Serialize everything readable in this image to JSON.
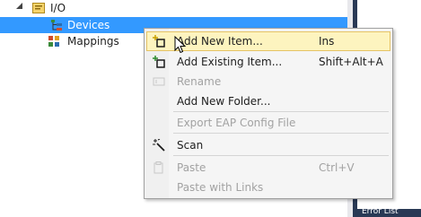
{
  "tree": {
    "items": [
      {
        "label": "I/O",
        "icon": "io-folder-icon",
        "expanded": true,
        "selected": false
      },
      {
        "label": "Devices",
        "icon": "devices-icon",
        "selected": true
      },
      {
        "label": "Mappings",
        "icon": "mappings-icon",
        "selected": false
      }
    ]
  },
  "context_menu": {
    "items": [
      {
        "label": "Add New Item...",
        "shortcut": "Ins",
        "icon": "add-new-item-icon",
        "enabled": true,
        "highlighted": true
      },
      {
        "label": "Add Existing Item...",
        "shortcut": "Shift+Alt+A",
        "icon": "add-existing-item-icon",
        "enabled": true
      },
      {
        "label": "Rename",
        "shortcut": "",
        "icon": "rename-icon",
        "enabled": false
      },
      {
        "label": "Add New Folder...",
        "shortcut": "",
        "enabled": true
      },
      {
        "label": "Export EAP Config File",
        "shortcut": "",
        "enabled": false
      },
      {
        "label": "Scan",
        "shortcut": "",
        "icon": "scan-wand-icon",
        "enabled": true
      },
      {
        "label": "Paste",
        "shortcut": "Ctrl+V",
        "icon": "paste-icon",
        "enabled": false
      },
      {
        "label": "Paste with Links",
        "shortcut": "",
        "enabled": false
      }
    ]
  },
  "right_pane": {
    "partial_text": "Error List"
  },
  "colors": {
    "selection": "#3399ff",
    "menu_background": "#f5f5f5",
    "menu_highlight": "#fdf4bf",
    "menu_highlight_border": "#e5c365",
    "disabled_text": "#a2a2a2",
    "dark_frame": "#293955"
  }
}
